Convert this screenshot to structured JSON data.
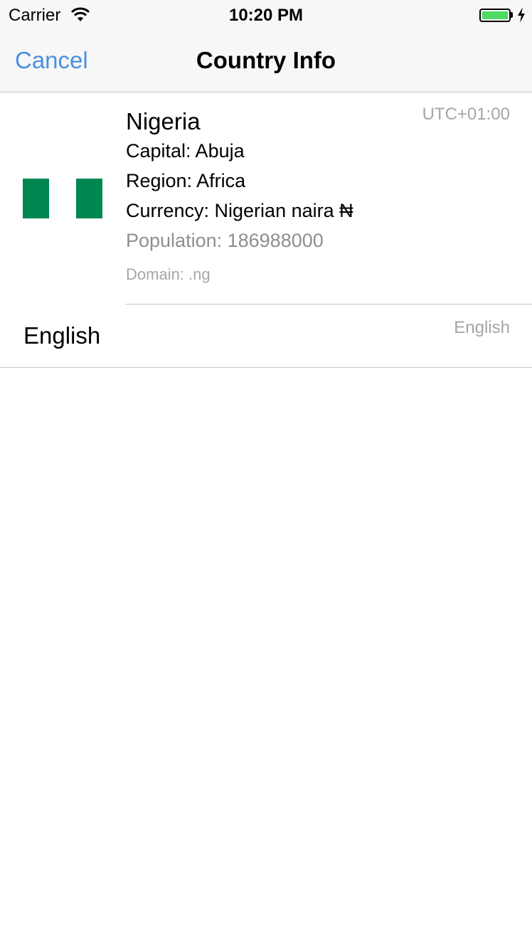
{
  "status_bar": {
    "carrier": "Carrier",
    "time": "10:20 PM",
    "battery_color": "#4cd964"
  },
  "nav": {
    "cancel_label": "Cancel",
    "title": "Country Info",
    "tint_color": "#4a90e2"
  },
  "country": {
    "name": "Nigeria",
    "timezone": "UTC+01:00",
    "capital": "Capital: Abuja",
    "region": "Region: Africa",
    "currency": "Currency: Nigerian naira ₦",
    "population": "Population: 186988000",
    "domain": "Domain: .ng",
    "flag_colors": [
      "#008751",
      "#ffffff",
      "#008751"
    ]
  },
  "language": {
    "name": "English",
    "native_name": "English"
  }
}
